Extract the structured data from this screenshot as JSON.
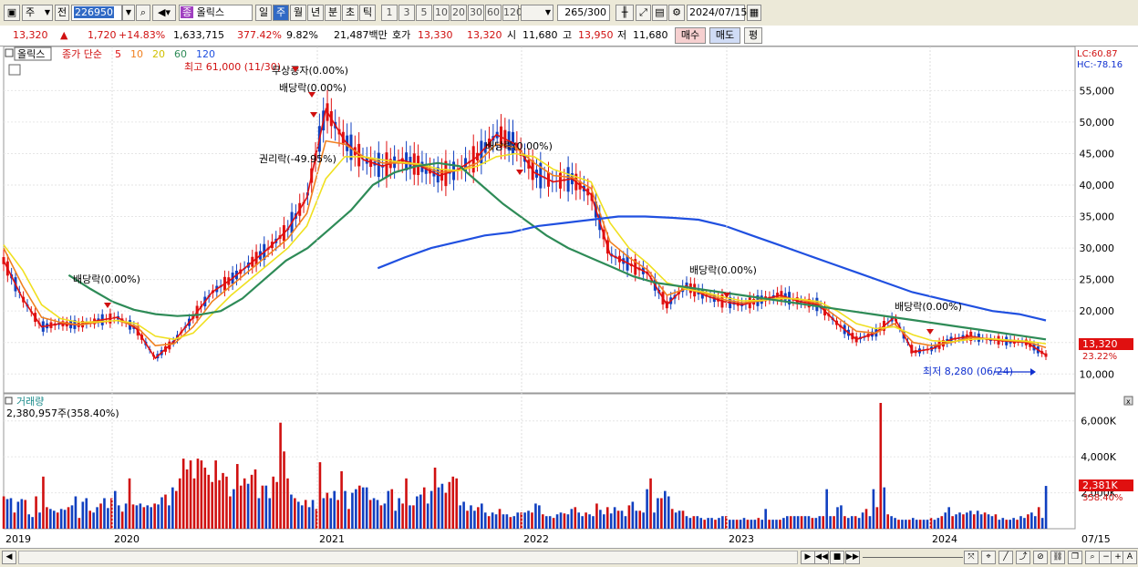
{
  "toolbar": {
    "period_select": "주",
    "prev_label": "전",
    "stock_code": "226950",
    "stock_name_badge": "종",
    "stock_name": "올릭스",
    "period_tabs": [
      "일",
      "주",
      "월",
      "년",
      "분",
      "초",
      "틱"
    ],
    "active_period_tab": "주",
    "interval_tabs": [
      "1",
      "3",
      "5",
      "10",
      "20",
      "30",
      "60",
      "120"
    ],
    "count_value": "265",
    "count_total": "/300",
    "date_value": "2024/07/15"
  },
  "quote": {
    "price": "13,320",
    "change": "1,720",
    "change_pct": "+14.83%",
    "volume": "1,633,715",
    "volume_pct": "377.42%",
    "turnover_pct": "9.82%",
    "amount": "21,487백만",
    "ask_label": "호가",
    "ask1": "13,330",
    "ask2": "13,320",
    "open_label": "시",
    "open": "11,680",
    "high_label": "고",
    "high": "13,950",
    "low_label": "저",
    "low": "11,680",
    "buy_button": "매수",
    "sell_button": "매도",
    "eval_button": "평"
  },
  "colors": {
    "candle_up": "#e01010",
    "candle_down": "#1040c0",
    "ma5": "#e01010",
    "ma10": "#f08020",
    "ma20": "#f0e020",
    "ma60": "#2e8b57",
    "ma120": "#2050e0",
    "volume_up": "#d01010",
    "volume_down": "#1040c0"
  },
  "chart_data": [
    {
      "type": "candlestick",
      "title": "올릭스",
      "legend": {
        "label": "종가 단순",
        "periods": [
          "5",
          "10",
          "20",
          "60",
          "120"
        ]
      },
      "series": [
        {
          "name": "5",
          "values": [
            28000,
            22000,
            17500,
            18000,
            17800,
            18500,
            19000,
            17200,
            12500,
            15200,
            19000,
            23000,
            25000,
            27500,
            30000,
            33000,
            38000,
            52000,
            47000,
            44000,
            43000,
            44000,
            43000,
            41500,
            42500,
            44500,
            48000,
            46500,
            42000,
            40500,
            41000,
            38500,
            29000,
            27500,
            26000,
            21000,
            24000,
            22500,
            21500,
            21000,
            21800,
            22500,
            21500,
            21000,
            18000,
            15500,
            16500,
            19000,
            13500,
            14000,
            15500,
            16000,
            15500,
            15200,
            15000,
            13000
          ]
        },
        {
          "name": "10",
          "values": [
            30000,
            24000,
            19000,
            18200,
            17800,
            18200,
            18500,
            17600,
            14500,
            14800,
            17500,
            21500,
            24000,
            26500,
            29000,
            31500,
            35500,
            47000,
            46500,
            44500,
            43500,
            43500,
            43200,
            42000,
            42300,
            43500,
            46500,
            46000,
            43500,
            41500,
            41200,
            39500,
            31000,
            28500,
            26500,
            22500,
            23500,
            22800,
            21800,
            21300,
            21600,
            22200,
            21800,
            21200,
            19000,
            16800,
            16500,
            18000,
            15000,
            14500,
            15000,
            15800,
            15600,
            15300,
            15100,
            14200
          ]
        },
        {
          "name": "20",
          "values": [
            30500,
            26500,
            21000,
            18800,
            18200,
            18300,
            18500,
            18000,
            16000,
            15500,
            16500,
            19500,
            22500,
            25000,
            27500,
            30000,
            33500,
            41000,
            44500,
            44500,
            44000,
            43600,
            43300,
            42500,
            42300,
            43000,
            44500,
            45000,
            44500,
            42500,
            41500,
            40500,
            34000,
            30000,
            27500,
            24500,
            23500,
            23000,
            22200,
            21600,
            21700,
            22000,
            21900,
            21500,
            20000,
            18000,
            17200,
            17500,
            16200,
            15300,
            15100,
            15500,
            15600,
            15400,
            15200,
            14800
          ]
        },
        {
          "name": "60",
          "values": [
            null,
            null,
            null,
            25700,
            23500,
            21500,
            20200,
            19500,
            19200,
            19400,
            20000,
            22000,
            25000,
            28000,
            30000,
            33000,
            36000,
            40000,
            42000,
            43000,
            43500,
            43000,
            40000,
            37000,
            34500,
            32000,
            30000,
            28500,
            27000,
            25500,
            24500,
            24000,
            23500,
            23000,
            22500,
            22000,
            21500,
            21000,
            20500,
            20000,
            19500,
            19000,
            18500,
            18000,
            17500,
            17000,
            16500,
            16000,
            15500
          ]
        },
        {
          "name": "120",
          "values": [
            null,
            null,
            null,
            null,
            null,
            null,
            null,
            null,
            null,
            null,
            null,
            null,
            null,
            null,
            26800,
            28500,
            30000,
            31000,
            32000,
            32500,
            33500,
            34000,
            34500,
            35000,
            35000,
            34800,
            34500,
            33500,
            32000,
            30500,
            29000,
            27500,
            26000,
            24500,
            23000,
            22000,
            21000,
            20000,
            19500,
            18500
          ]
        }
      ],
      "annotations": [
        {
          "text": "최고 61,000 (11/30)"
        },
        {
          "text": "무상증자(0.00%)"
        },
        {
          "text": "배당락(0.00%)"
        },
        {
          "text": "권리락(-49.95%)"
        },
        {
          "text": "배당락(0.00%)"
        },
        {
          "text": "배당락(0.00%)"
        },
        {
          "text": "배당락(0.00%)"
        },
        {
          "text": "배당락(0.00%)"
        },
        {
          "text": "최저 8,280 (06/24)"
        }
      ],
      "ylim": [
        7000,
        62000
      ],
      "y_ticks": [
        "10,000",
        "15,000",
        "20,000",
        "25,000",
        "30,000",
        "35,000",
        "40,000",
        "45,000",
        "50,000",
        "55,000"
      ],
      "y_tick_values": [
        10000,
        15000,
        20000,
        25000,
        30000,
        35000,
        40000,
        45000,
        50000,
        55000
      ],
      "x_labels": [
        "2019",
        "2020",
        "2021",
        "2022",
        "2023",
        "2024",
        "07/15"
      ],
      "price_tag": "13,320",
      "price_tag_pct": "23.22%",
      "lc": "LC:60.87",
      "hc": "HC:-78.16"
    },
    {
      "type": "bar",
      "title": "거래량",
      "value_label": "2,380,957주(358.40%)",
      "y_ticks": [
        "2,000K",
        "4,000K",
        "6,000K"
      ],
      "y_tick_values": [
        2000,
        4000,
        6000
      ],
      "ylim": [
        0,
        7000
      ],
      "values": [
        1800,
        1650,
        1700,
        900,
        1500,
        1650,
        1600,
        800,
        650,
        1800,
        900,
        2900,
        1200,
        1100,
        1000,
        900,
        1100,
        1050,
        1200,
        1300,
        1800,
        600,
        1500,
        1700,
        1000,
        900,
        1200,
        1400,
        1700,
        1150,
        1700,
        2100,
        1300,
        950,
        1400,
        2800,
        1350,
        1300,
        1400,
        1200,
        1300,
        1200,
        1400,
        1350,
        1750,
        1900,
        1300,
        2300,
        2100,
        2800,
        3900,
        3300,
        3800,
        2800,
        3900,
        3800,
        3400,
        3000,
        2600,
        3800,
        2700,
        3100,
        2900,
        1800,
        2200,
        3600,
        2400,
        2800,
        2500,
        3000,
        3300,
        1700,
        2400,
        2400,
        1700,
        2900,
        2600,
        5900,
        4300,
        2800,
        1900,
        1700,
        1500,
        1300,
        1600,
        1200,
        1600,
        1100,
        3700,
        1700,
        2000,
        1700,
        2100,
        1600,
        3200,
        2100,
        1100,
        2000,
        2200,
        2400,
        2300,
        2300,
        1600,
        1700,
        1600,
        1300,
        1400,
        2100,
        2200,
        1000,
        1700,
        1400,
        2800,
        1300,
        1300,
        1800,
        1900,
        2300,
        1400,
        2100,
        3400,
        2300,
        2500,
        2000,
        2600,
        2900,
        2800,
        1300,
        1500,
        1000,
        1300,
        1000,
        1200,
        1400,
        900,
        700,
        900,
        800,
        1100,
        800,
        800,
        650,
        700,
        900,
        900,
        900,
        1000,
        900,
        1400,
        1300,
        800,
        700,
        700,
        600,
        800,
        900,
        850,
        800,
        1100,
        1200,
        900,
        700,
        900,
        800,
        700,
        1400,
        1050,
        800,
        1200,
        850,
        1200,
        1000,
        1000,
        700,
        1300,
        1500,
        1000,
        1000,
        900,
        2200,
        2800,
        900,
        1700,
        1700,
        2100,
        1800,
        1100,
        900,
        1000,
        1000,
        700,
        600,
        700,
        700,
        600,
        500,
        600,
        600,
        500,
        600,
        700,
        700,
        500,
        500,
        500,
        500,
        600,
        500,
        500,
        500,
        600,
        500,
        1100,
        500,
        500,
        500,
        500,
        600,
        700,
        700,
        700,
        700,
        700,
        700,
        700,
        600,
        600,
        700,
        700,
        2200,
        700,
        700,
        1200,
        1300,
        700,
        600,
        700,
        700,
        600,
        900,
        1100,
        700,
        2200,
        1200,
        7000,
        2300,
        800,
        700,
        600,
        500,
        500,
        500,
        500,
        600,
        500,
        500,
        500,
        500,
        600,
        500,
        600,
        700,
        900,
        1200,
        700,
        800,
        900,
        800,
        900,
        1000,
        800,
        1000,
        800,
        900,
        800,
        700,
        800,
        500,
        600,
        500,
        500,
        600,
        500,
        700,
        600,
        800,
        900,
        700,
        1200,
        600,
        2381
      ],
      "price_tag": "2,381K",
      "price_tag_pct": "358.40%"
    }
  ]
}
